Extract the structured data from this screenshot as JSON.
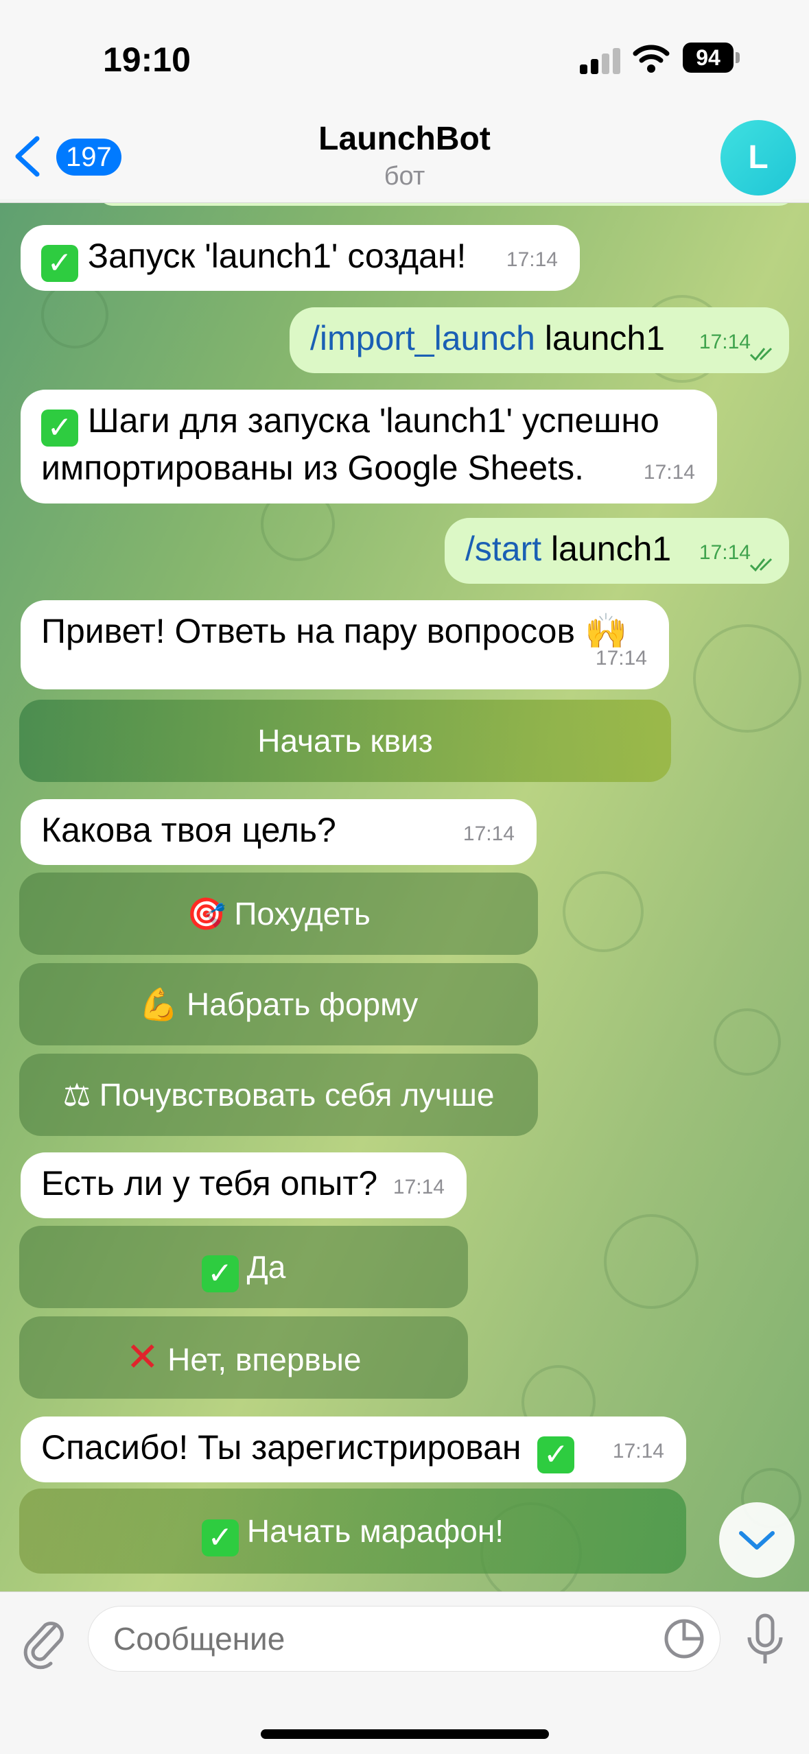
{
  "status": {
    "time": "19:10",
    "battery": "94"
  },
  "header": {
    "back_count": "197",
    "title": "LaunchBot",
    "subtitle": "бот",
    "avatar_letter": "L"
  },
  "messages": [
    {
      "text": "Запуск 'launch1' создан!",
      "time": "17:14"
    },
    {
      "cmd": "/import_launch",
      "arg": "launch1",
      "time": "17:14"
    },
    {
      "line1": "Шаги для запуска 'launch1' успешно",
      "line2": "импортированы из Google Sheets.",
      "time": "17:14"
    },
    {
      "cmd": "/start",
      "arg": "launch1",
      "time": "17:14"
    },
    {
      "text": "Привет! Ответь на пару вопросов 🙌",
      "time": "17:14"
    },
    {
      "text": "Какова твоя цель?",
      "time": "17:14"
    },
    {
      "text": "Есть ли у тебя опыт?",
      "time": "17:14"
    },
    {
      "text": "Спасибо! Ты зарегистрирован",
      "time": "17:14"
    }
  ],
  "buttons": {
    "start_quiz": "Начать квиз",
    "lose_weight": "Похудеть",
    "get_fit": "Набрать форму",
    "feel_better": "Почувствовать себя лучше",
    "yes": "Да",
    "no_first": "Нет, впервые",
    "start_marathon": "Начать марафон!"
  },
  "input": {
    "placeholder": "Сообщение"
  }
}
